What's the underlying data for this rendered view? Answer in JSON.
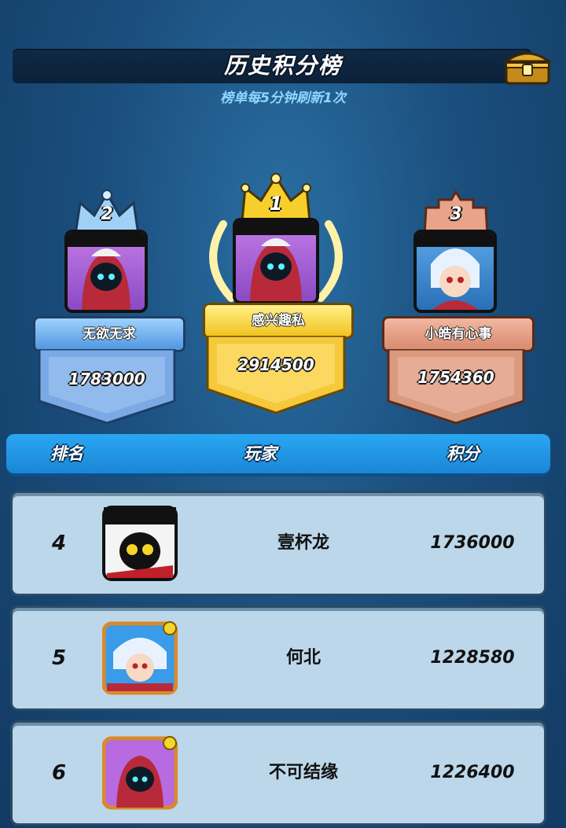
{
  "header": {
    "title": "历史积分榜",
    "subtitle": "榜单每5分钟刷新1次",
    "chest_icon": "treasure-chest-icon"
  },
  "podium": [
    {
      "rank": "2",
      "name": "无欲无求",
      "score": "1783000",
      "color": "#7ab4ef"
    },
    {
      "rank": "1",
      "name": "感兴趣私",
      "score": "2914500",
      "color": "#f5c93a"
    },
    {
      "rank": "3",
      "name": "小皓有心事",
      "score": "1754360",
      "color": "#d99a80"
    }
  ],
  "table": {
    "columns": [
      "排名",
      "玩家",
      "积分"
    ],
    "rows": [
      {
        "rank": "4",
        "name": "壹杯龙",
        "score": "1736000"
      },
      {
        "rank": "5",
        "name": "何北",
        "score": "1228580"
      },
      {
        "rank": "6",
        "name": "不可结缘",
        "score": "1226400"
      }
    ]
  }
}
